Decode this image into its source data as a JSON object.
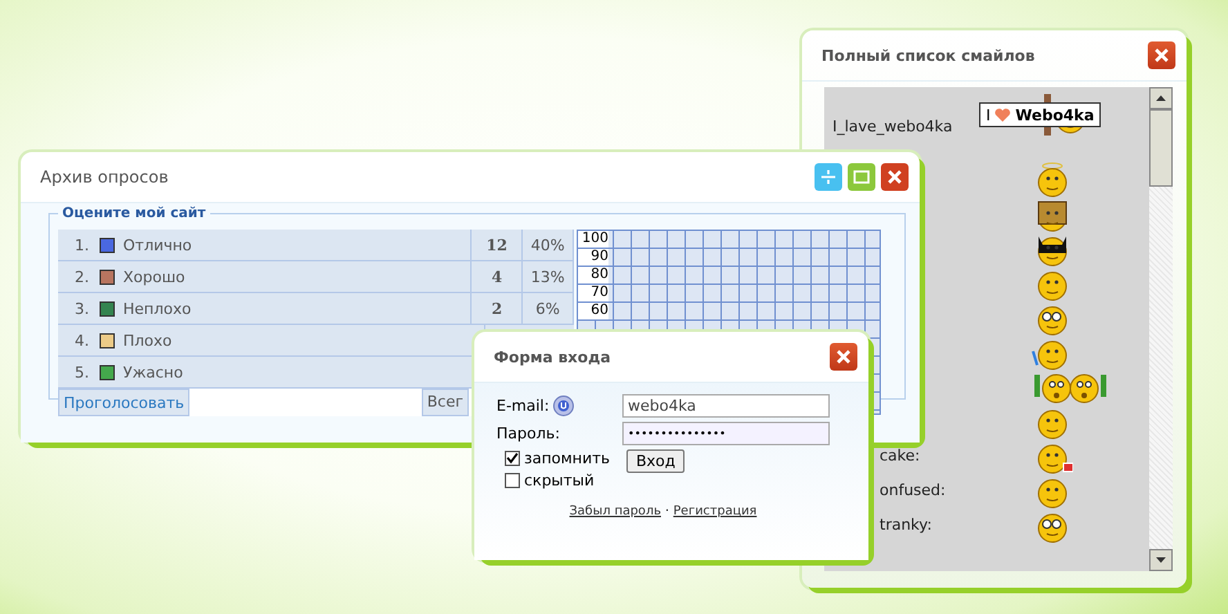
{
  "smiley_window": {
    "title": "Полный список смайлов",
    "rows": [
      {
        "label": "I_lave_webo4ka",
        "kind": "sign",
        "sign_text": "I",
        "sign_brand": "Webo4ka",
        "label_cut": false
      },
      {
        "kind": "halo"
      },
      {
        "kind": "bag"
      },
      {
        "kind": "mask"
      },
      {
        "kind": "plain"
      },
      {
        "kind": "glasses"
      },
      {
        "kind": "stick"
      },
      {
        "kind": "pair"
      },
      {
        "kind": "plain"
      },
      {
        "label": "cake:",
        "kind": "cake",
        "label_cut": true
      },
      {
        "label": "onfused:",
        "kind": "plain",
        "label_cut": true
      },
      {
        "label": "tranky:",
        "kind": "glasses",
        "label_cut": true
      }
    ]
  },
  "poll_window": {
    "title": "Архив опросов",
    "legend": "Оцените мой сайт",
    "options": [
      {
        "number": "1.",
        "label": "Отлично",
        "color": "#4a68e0",
        "count": "12",
        "percent": "40%"
      },
      {
        "number": "2.",
        "label": "Хорошо",
        "color": "#b87560",
        "count": "4",
        "percent": "13%"
      },
      {
        "number": "3.",
        "label": "Неплохо",
        "color": "#348450",
        "count": "2",
        "percent": "6%"
      },
      {
        "number": "4.",
        "label": "Плохо",
        "color": "#eccb88"
      },
      {
        "number": "5.",
        "label": "Ужасно",
        "color": "#44a84c"
      }
    ],
    "vote_button": "Проголосовать",
    "total_label": "Всег",
    "chart_ticks": [
      "100",
      "90",
      "80",
      "70",
      "60"
    ]
  },
  "login_window": {
    "title": "Форма входа",
    "email_label": "E-mail:",
    "email_value": "webo4ka",
    "password_label": "Пароль:",
    "password_value": "•••••••••••••••",
    "checkboxes": [
      {
        "label": "запомнить",
        "checked": true
      },
      {
        "label": "скрытый",
        "checked": false
      }
    ],
    "submit_button": "Вход",
    "links": [
      "Забыл пароль",
      "Регистрация"
    ],
    "link_separator": "·"
  }
}
